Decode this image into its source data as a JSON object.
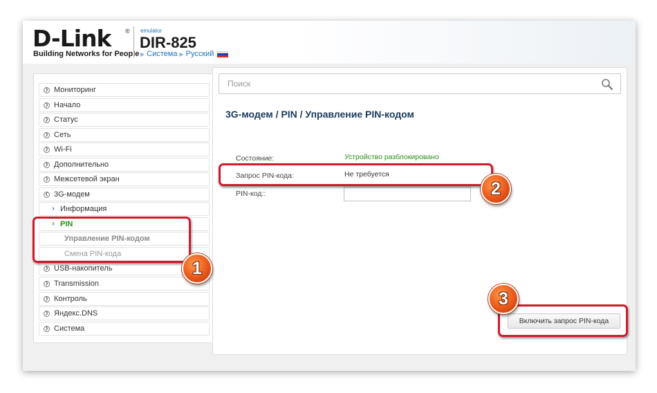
{
  "header": {
    "logo_text": "D-Link",
    "logo_reg": "®",
    "tagline": "Building Networks for People",
    "emulator_label": "emulator",
    "model": "DIR-825",
    "crumb_system": "Система",
    "crumb_language": "Русский"
  },
  "search": {
    "placeholder": "Поиск"
  },
  "sidebar": {
    "items": [
      {
        "label": "Мониторинг"
      },
      {
        "label": "Начало"
      },
      {
        "label": "Статус"
      },
      {
        "label": "Сеть"
      },
      {
        "label": "Wi-Fi"
      },
      {
        "label": "Дополнительно"
      },
      {
        "label": "Межсетевой экран"
      },
      {
        "label": "3G-модем"
      },
      {
        "label": "Информация"
      },
      {
        "label": "PIN"
      },
      {
        "label": "Управление PIN-кодом"
      },
      {
        "label": "Смена PIN-кода"
      },
      {
        "label": "USB-накопитель"
      },
      {
        "label": "Transmission"
      },
      {
        "label": "Контроль"
      },
      {
        "label": "Яндекс.DNS"
      },
      {
        "label": "Система"
      }
    ]
  },
  "main": {
    "breadcrumb_title": "3G-модем /  PIN /  Управление PIN-кодом",
    "status_label": "Состояние:",
    "status_value": "Устройство разблокировано",
    "pin_request_label": "Запрос PIN-кода:",
    "pin_request_value": "Не требуется",
    "pin_label": "PIN-код::",
    "pin_value": "",
    "enable_button": "Включить запрос PIN-кода"
  },
  "annotations": {
    "badge1": "1",
    "badge2": "2",
    "badge3": "3",
    "highlight_color": "#d0192b",
    "badge_color": "#e8571a"
  },
  "colors": {
    "accent_blue": "#1e73b9",
    "active_green": "#2e8b1e",
    "title_navy": "#1a3a5c"
  }
}
